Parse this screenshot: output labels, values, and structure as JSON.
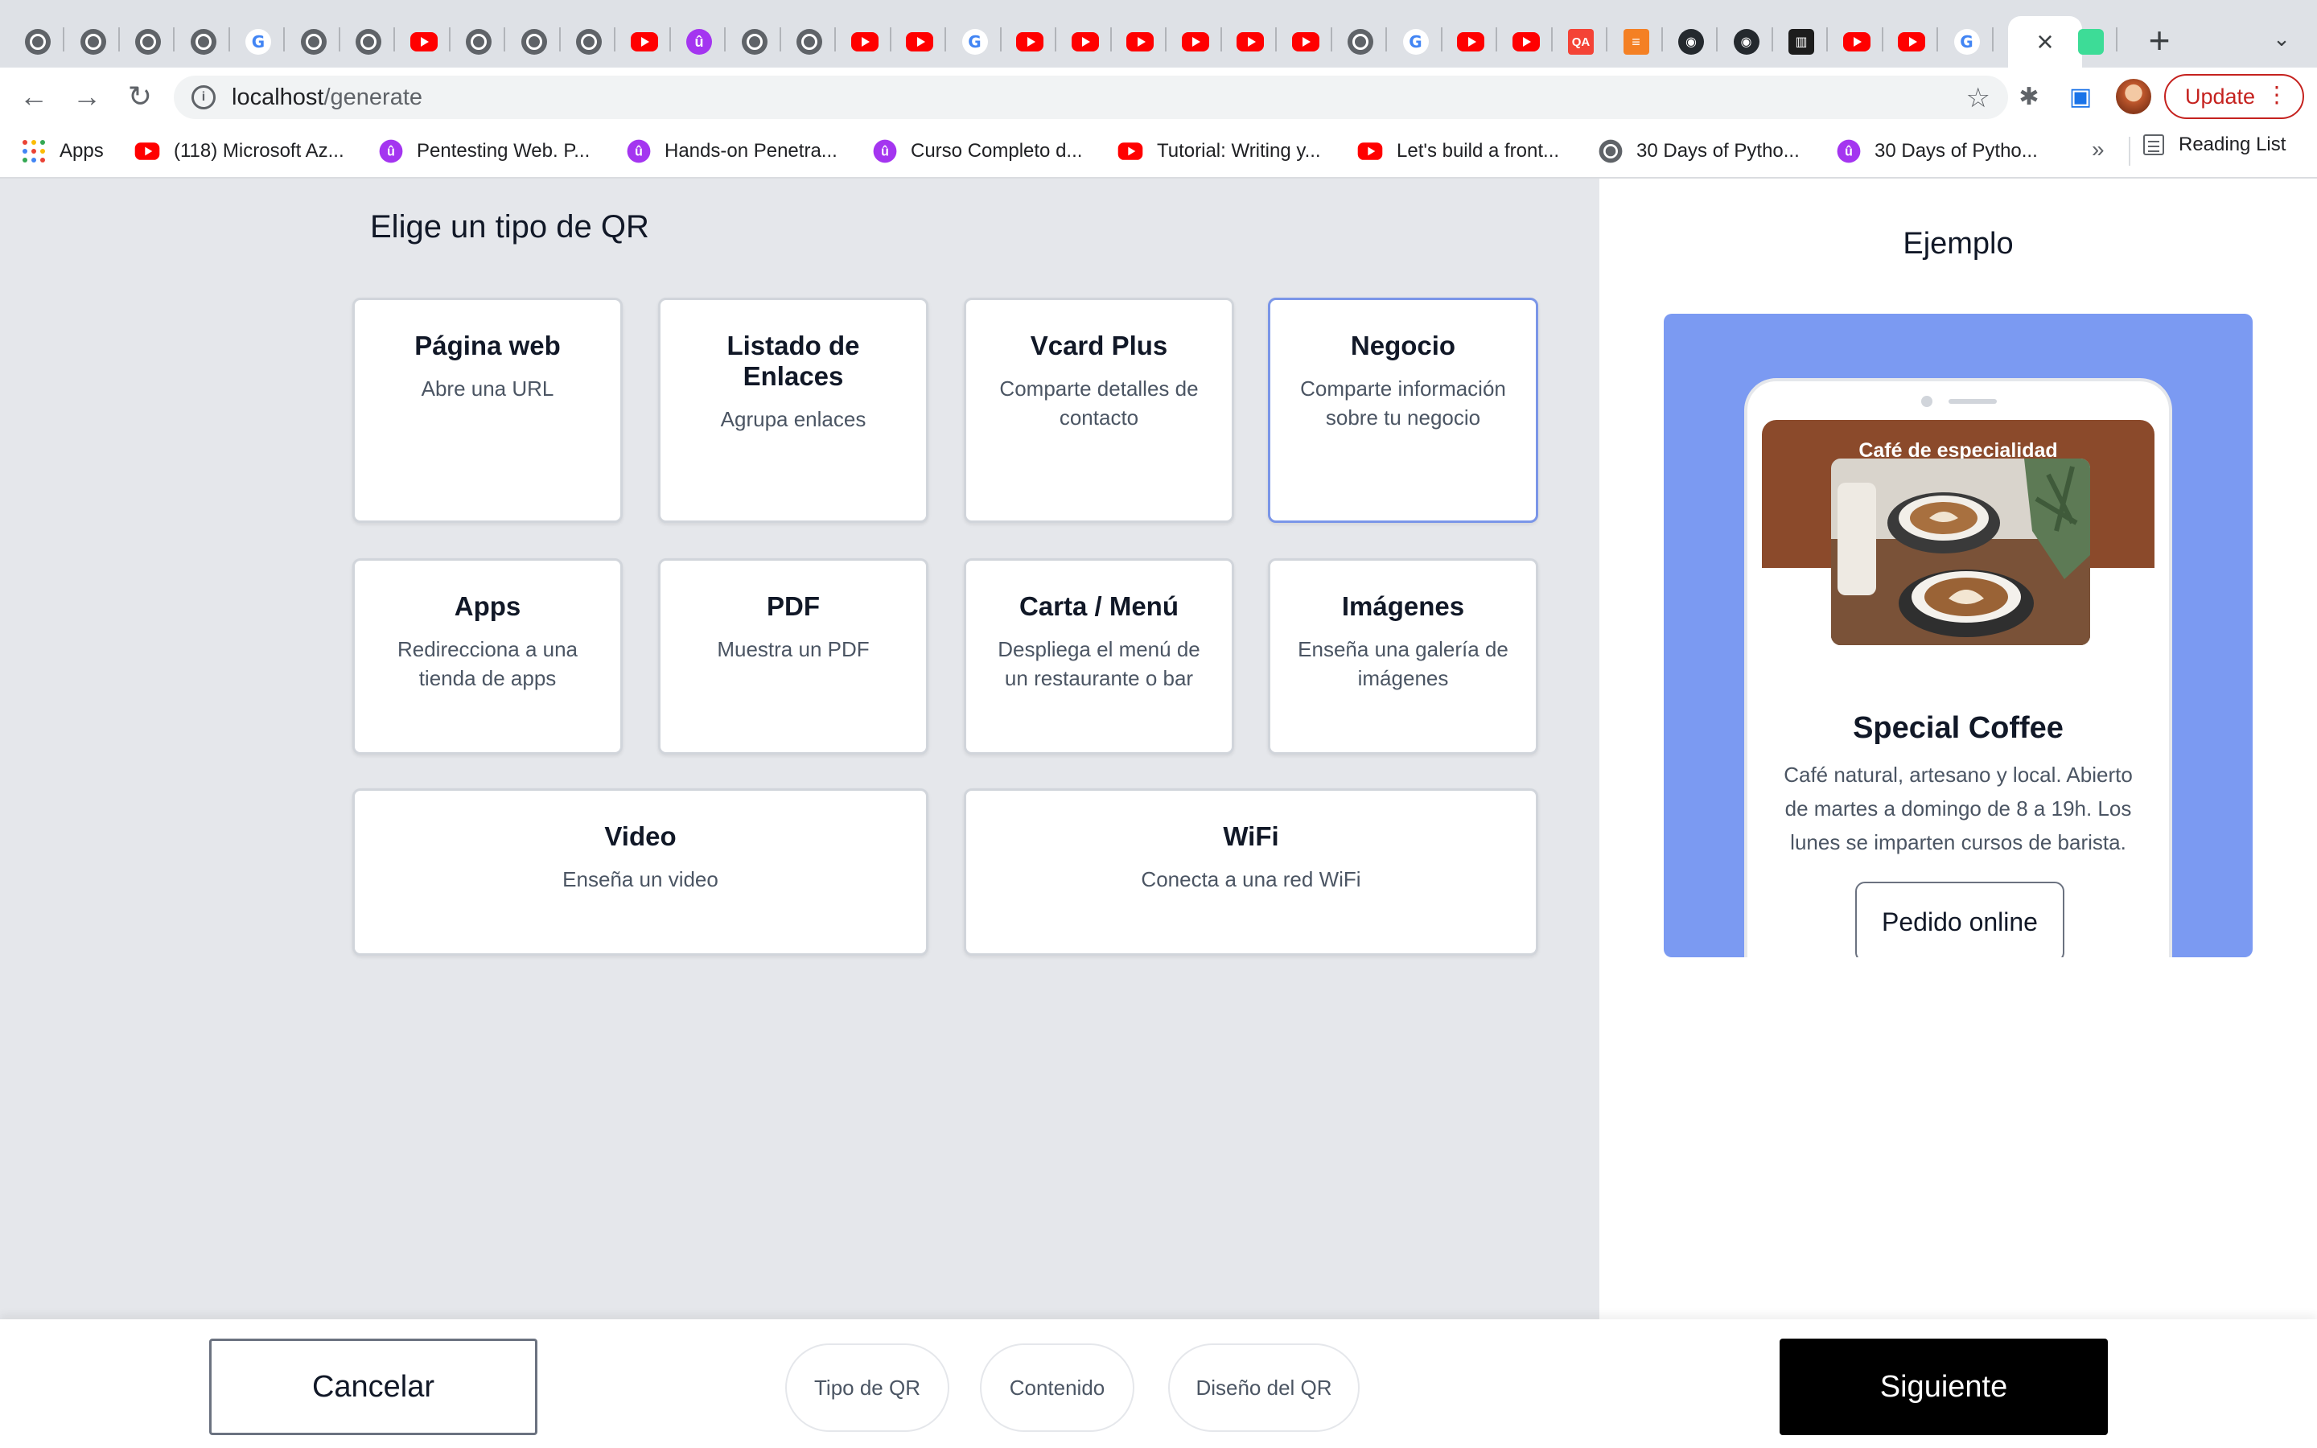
{
  "browser": {
    "tabs": [
      {
        "icon": "globe"
      },
      {
        "icon": "globe"
      },
      {
        "icon": "globe"
      },
      {
        "icon": "globe"
      },
      {
        "icon": "google"
      },
      {
        "icon": "globe"
      },
      {
        "icon": "globe"
      },
      {
        "icon": "youtube"
      },
      {
        "icon": "globe"
      },
      {
        "icon": "globe"
      },
      {
        "icon": "globe"
      },
      {
        "icon": "youtube"
      },
      {
        "icon": "udemy"
      },
      {
        "icon": "globe"
      },
      {
        "icon": "globe"
      },
      {
        "icon": "youtube"
      },
      {
        "icon": "youtube"
      },
      {
        "icon": "google"
      },
      {
        "icon": "youtube"
      },
      {
        "icon": "youtube"
      },
      {
        "icon": "youtube"
      },
      {
        "icon": "youtube"
      },
      {
        "icon": "youtube"
      },
      {
        "icon": "youtube"
      },
      {
        "icon": "globe"
      },
      {
        "icon": "google"
      },
      {
        "icon": "youtube"
      },
      {
        "icon": "youtube"
      },
      {
        "icon": "qa"
      },
      {
        "icon": "stackoverflow"
      },
      {
        "icon": "github"
      },
      {
        "icon": "github"
      },
      {
        "icon": "trello"
      },
      {
        "icon": "youtube"
      },
      {
        "icon": "youtube"
      },
      {
        "icon": "google"
      },
      {
        "icon": "close",
        "active": true
      },
      {
        "icon": "square-app"
      }
    ],
    "url_host": "localhost",
    "url_path": "/generate",
    "update_label": "Update",
    "bookmarks": [
      {
        "icon": "apps",
        "label": "Apps"
      },
      {
        "icon": "youtube",
        "label": "(118) Microsoft Az..."
      },
      {
        "icon": "udemy",
        "label": "Pentesting Web. P..."
      },
      {
        "icon": "udemy",
        "label": "Hands-on Penetra..."
      },
      {
        "icon": "udemy",
        "label": "Curso Completo d..."
      },
      {
        "icon": "youtube",
        "label": "Tutorial: Writing y..."
      },
      {
        "icon": "youtube",
        "label": "Let's build a front..."
      },
      {
        "icon": "globe",
        "label": "30 Days of Pytho..."
      },
      {
        "icon": "udemy",
        "label": "30 Days of Pytho..."
      }
    ],
    "more_bookmarks": "»",
    "reading_list": "Reading List"
  },
  "main": {
    "title": "Elige un tipo de QR",
    "types": [
      {
        "title": "Página web",
        "desc": "Abre una URL",
        "selected": false
      },
      {
        "title": "Listado de Enlaces",
        "desc": "Agrupa enlaces",
        "selected": false
      },
      {
        "title": "Vcard Plus",
        "desc": "Comparte detalles de contacto",
        "selected": false
      },
      {
        "title": "Negocio",
        "desc": "Comparte información sobre tu negocio",
        "selected": true
      },
      {
        "title": "Apps",
        "desc": "Redirecciona a una tienda de apps",
        "selected": false
      },
      {
        "title": "PDF",
        "desc": "Muestra un PDF",
        "selected": false
      },
      {
        "title": "Carta / Menú",
        "desc": "Despliega el menú de un restaurante o bar",
        "selected": false
      },
      {
        "title": "Imágenes",
        "desc": "Enseña una galería de imágenes",
        "selected": false
      },
      {
        "title": "Video",
        "desc": "Enseña un video",
        "selected": false
      },
      {
        "title": "WiFi",
        "desc": "Conecta a una red WiFi",
        "selected": false
      }
    ]
  },
  "preview": {
    "title": "Ejemplo",
    "header": "Café de especialidad",
    "business_name": "Special Coffee",
    "description": "Café natural, artesano y local. Abierto de martes a domingo de 8 a 19h. Los lunes se imparten cursos de barista.",
    "button": "Pedido online",
    "colors": {
      "background": "#7b9af2",
      "header": "#8b4a2b"
    }
  },
  "footer": {
    "cancel": "Cancelar",
    "steps": [
      "Tipo de QR",
      "Contenido",
      "Diseño del QR"
    ],
    "next": "Siguiente"
  }
}
